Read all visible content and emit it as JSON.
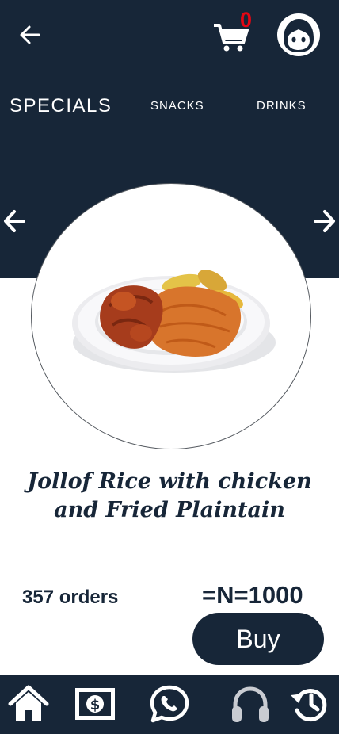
{
  "header": {
    "back_icon": "arrow-left-icon",
    "cart_icon": "shopping-cart-icon",
    "cart_count": "0",
    "profile_icon": "user-avatar-icon"
  },
  "tabs": [
    {
      "label": "SPECIALS",
      "active": true
    },
    {
      "label": "SNACKS",
      "active": false
    },
    {
      "label": "DRINKS",
      "active": false
    }
  ],
  "carousel": {
    "prev_icon": "arrow-left-icon",
    "next_icon": "arrow-right-icon",
    "image": "jollof-rice-chicken-plantain-plate"
  },
  "product": {
    "name": "Jollof Rice with chicken and Fried Plaintain",
    "orders": "357 orders",
    "price": "=N=1000",
    "buy_label": "Buy"
  },
  "bottom_nav": [
    {
      "icon": "home-icon"
    },
    {
      "icon": "money-icon"
    },
    {
      "icon": "whatsapp-icon"
    },
    {
      "icon": "headphones-icon"
    },
    {
      "icon": "history-icon"
    }
  ],
  "colors": {
    "primary": "#172638",
    "accent": "#e30613",
    "background": "#ffffff"
  }
}
